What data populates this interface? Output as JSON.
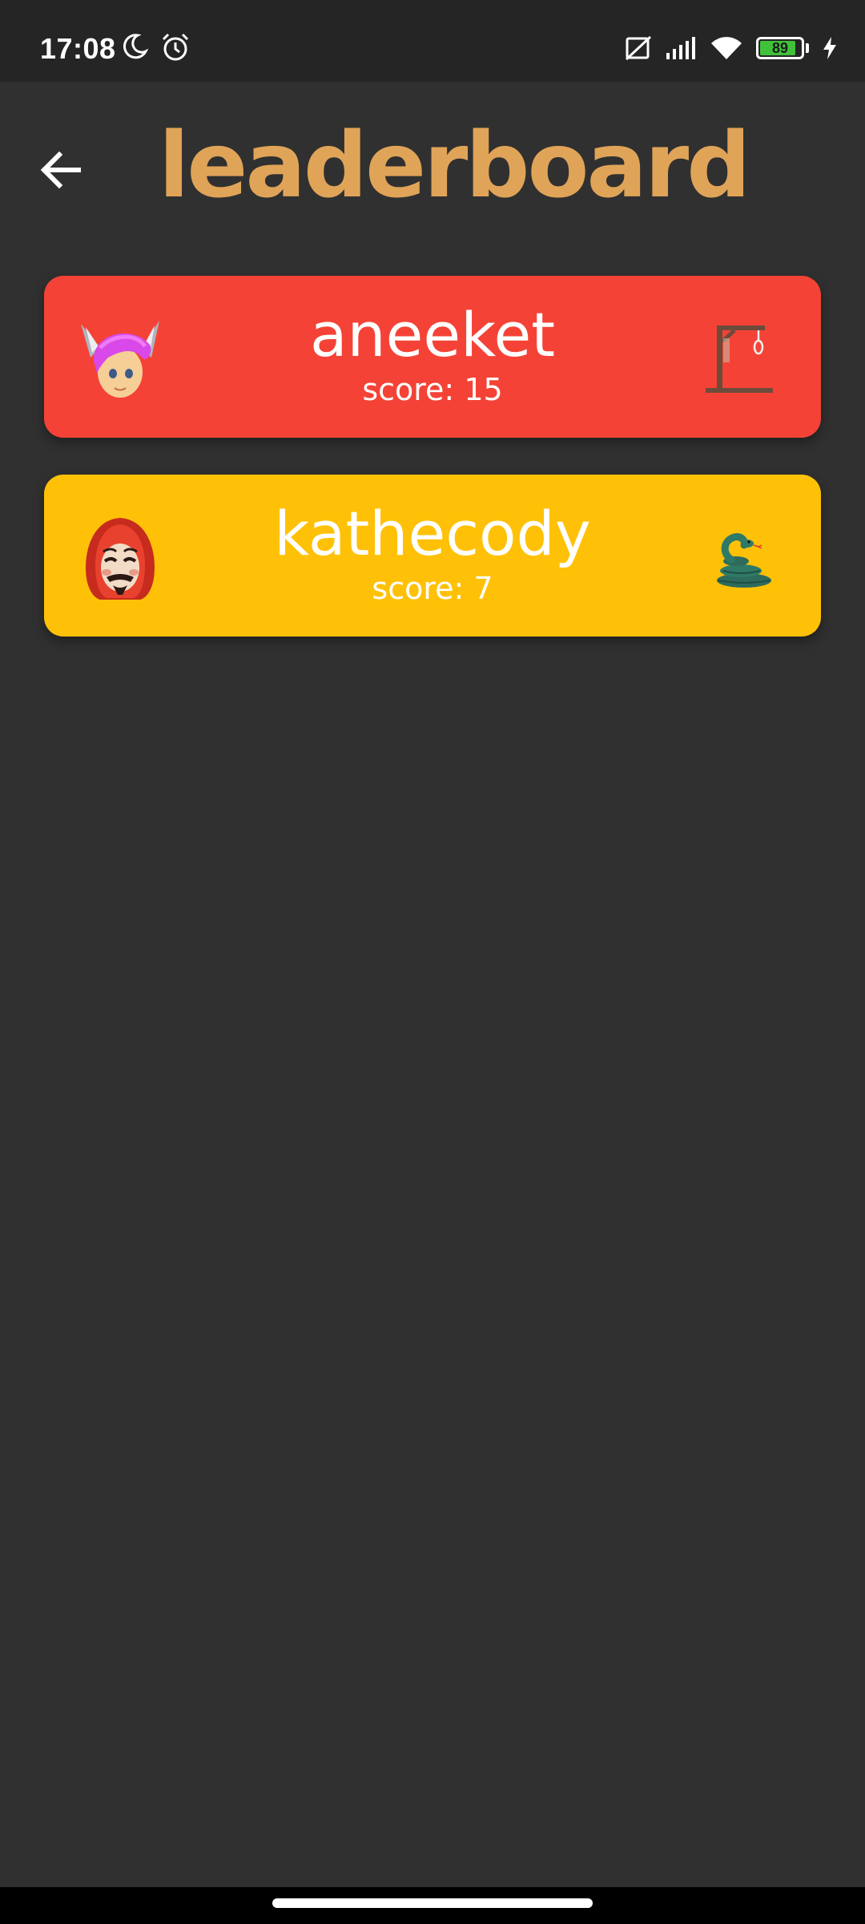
{
  "status_bar": {
    "time": "17:08",
    "battery_level": "89",
    "battery_fraction": 0.89
  },
  "header": {
    "title": "leaderboard"
  },
  "players": [
    {
      "name": "aneeket",
      "score_text": "score: 15",
      "color": "#f44336",
      "avatar_icon": "fox-hair-avatar-icon",
      "game_icon": "gallows-icon"
    },
    {
      "name": "kathecody",
      "score_text": "score: 7",
      "color": "#ffc107",
      "avatar_icon": "dali-mask-avatar-icon",
      "game_icon": "snake-icon"
    }
  ],
  "colors": {
    "background": "#303030",
    "title": "#e0a458",
    "status_bar": "#252525"
  }
}
